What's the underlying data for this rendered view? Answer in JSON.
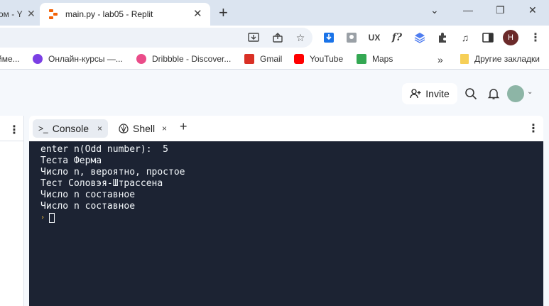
{
  "browser": {
    "prev_tab_label": "ом - Y",
    "active_tab_title": "main.py - lab05 - Replit",
    "new_tab_label": "+",
    "window_controls": [
      "⌄",
      "—",
      "❐",
      "✕"
    ]
  },
  "toolbar": {
    "icons": [
      "install-icon",
      "share-icon",
      "star-icon",
      "download-ext-icon",
      "puzzle-ext-icon",
      "ux-ext-icon",
      "fx-ext-icon",
      "layers-ext-icon",
      "extensions-icon",
      "media-icon",
      "sidepanel-icon"
    ],
    "profile_letter": "H"
  },
  "bookmarks": {
    "items": [
      {
        "label": "йме...",
        "icon_color": "#ffffff"
      },
      {
        "label": "Онлайн-курсы —...",
        "icon_color": "#7b3fe4"
      },
      {
        "label": "Dribbble - Discover...",
        "icon_color": "#ea4c89"
      },
      {
        "label": "Gmail",
        "icon_color": "#d93025"
      },
      {
        "label": "YouTube",
        "icon_color": "#ff0000"
      },
      {
        "label": "Maps",
        "icon_color": "#34a853"
      }
    ],
    "overflow": "»",
    "other_bookmarks": "Другие закладки"
  },
  "replit_header": {
    "invite_label": "Invite"
  },
  "panes": {
    "left_menu": "⋮",
    "tabs": [
      {
        "label": "Console",
        "icon": ">_"
      },
      {
        "label": "Shell",
        "icon": "shell-icon"
      }
    ],
    "close_glyph": "×",
    "add_glyph": "+",
    "menu_glyph": "⋮"
  },
  "console": {
    "lines": [
      "enter n(Odd number):  5",
      "Теста Ферма",
      "Число n, вероятно, простое",
      "Тест Соловэя-Штрассена",
      "Число n составное",
      "Число n составное"
    ],
    "prompt_glyph": "›"
  },
  "colors": {
    "terminal_bg": "#1c2333",
    "terminal_fg": "#f5f9fc",
    "prompt_accent": "#e8b93c",
    "replit_orange": "#f26207"
  }
}
